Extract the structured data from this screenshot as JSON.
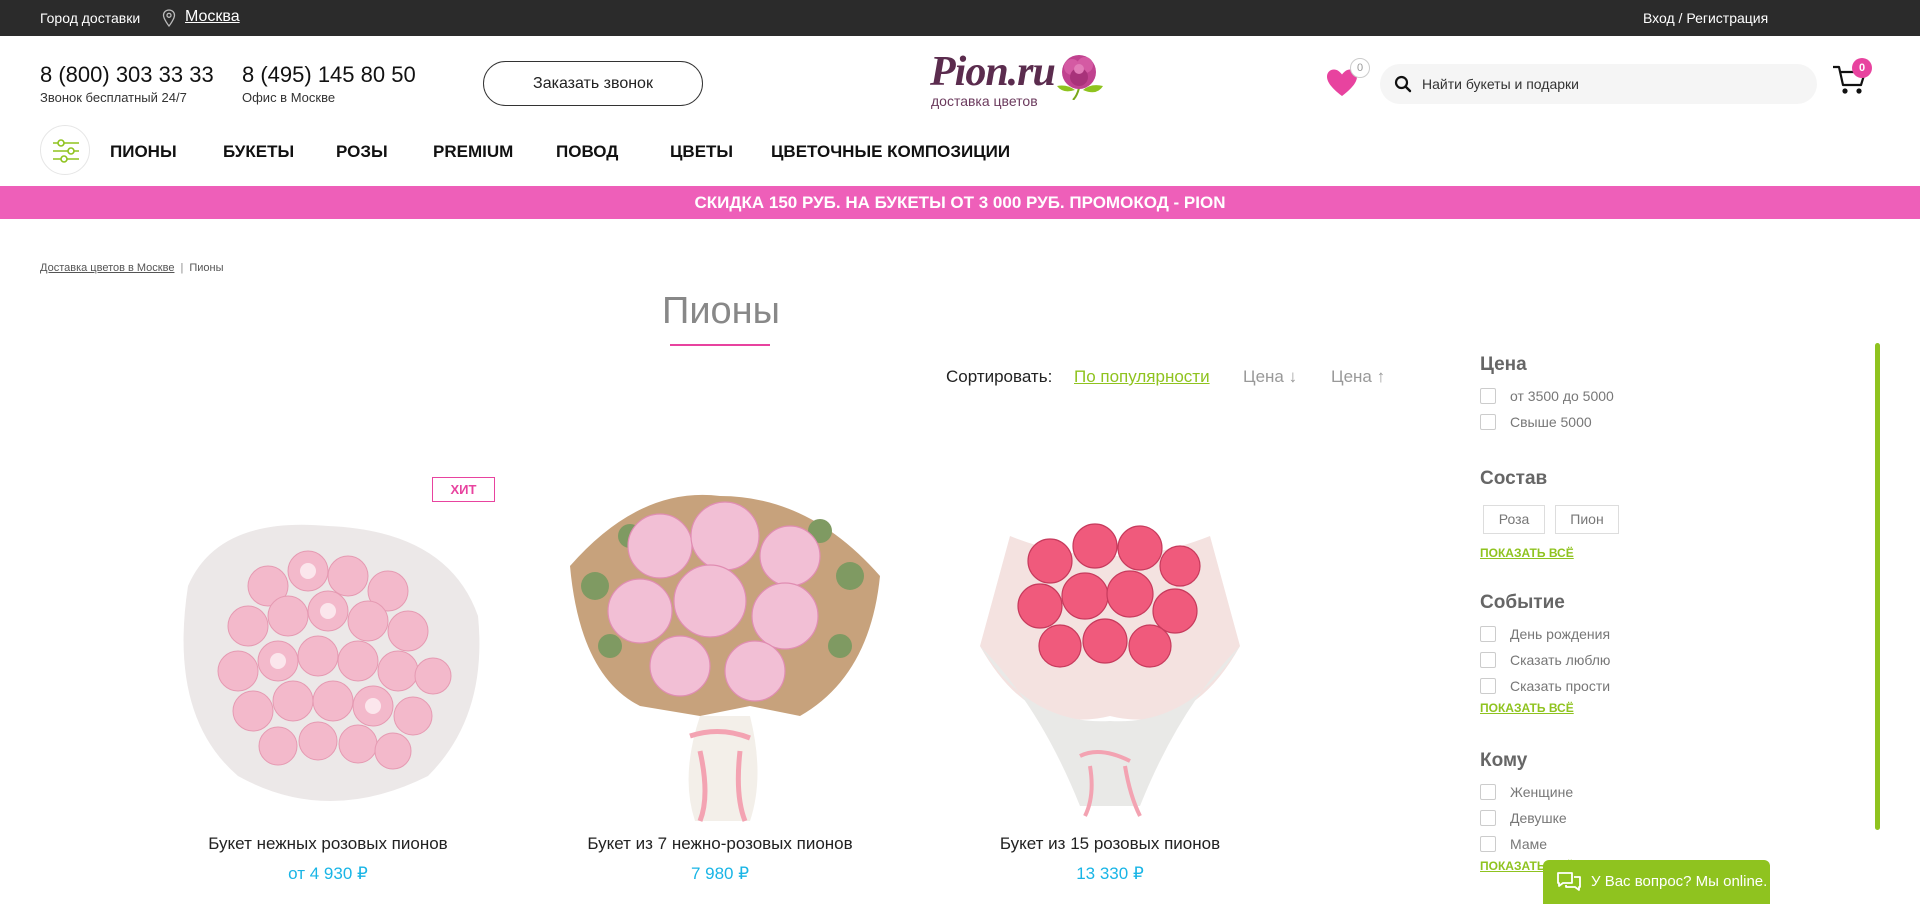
{
  "topbar": {
    "city_label": "Город доставки",
    "city": "Москва",
    "auth": "Вход / Регистрация"
  },
  "header": {
    "phone1": "8 (800) 303 33 33",
    "phone1_sub": "Звонок бесплатный 24/7",
    "phone2": "8 (495) 145 80 50",
    "phone2_sub": "Офис в Москве",
    "callback_label": "Заказать звонок",
    "logo_text": "Pion.ru",
    "logo_sub": "доставка цветов",
    "wishlist_count": "0",
    "search_placeholder": "Найти букеты и подарки",
    "cart_count": "0"
  },
  "nav": {
    "items": [
      "ПИОНЫ",
      "БУКЕТЫ",
      "РОЗЫ",
      "PREMIUM",
      "ПОВОД",
      "ЦВЕТЫ",
      "ЦВЕТОЧНЫЕ КОМПОЗИЦИИ"
    ]
  },
  "promo": "СКИДКА 150 РУБ. НА БУКЕТЫ ОТ 3 000 РУБ. ПРОМОКОД - PION",
  "breadcrumb": {
    "home": "Доставка цветов в Москве",
    "current": "Пионы"
  },
  "page_title": "Пионы",
  "sort": {
    "label": "Сортировать:",
    "options": [
      "По популярности",
      "Цена ↓",
      "Цена ↑"
    ],
    "active": "По популярности"
  },
  "products": [
    {
      "name": "Букет нежных розовых пионов",
      "price": "от 4 930 ₽",
      "badge": "ХИТ"
    },
    {
      "name": "Букет из 7 нежно-розовых пионов",
      "price": "7 980 ₽"
    },
    {
      "name": "Букет из 15 розовых пионов",
      "price": "13 330 ₽"
    }
  ],
  "filters": {
    "price": {
      "title": "Цена",
      "options": [
        "от 3500 до 5000",
        "Свыше 5000"
      ]
    },
    "composition": {
      "title": "Состав",
      "tags": [
        "Роза",
        "Пион"
      ],
      "more": "ПОКАЗАТЬ ВСЁ"
    },
    "event": {
      "title": "Событие",
      "options": [
        "День рождения",
        "Сказать люблю",
        "Сказать прости"
      ],
      "more": "ПОКАЗАТЬ ВСЁ"
    },
    "recipient": {
      "title": "Кому",
      "options": [
        "Женщине",
        "Девушке",
        "Маме"
      ],
      "more": "ПОКАЗАТЬ ВСЁ"
    }
  },
  "chat": "У Вас вопрос? Мы online.",
  "colors": {
    "accent_pink": "#e8439f",
    "promo_pink": "#ee5fb9",
    "green": "#8fc31f",
    "price_blue": "#19b5e6"
  }
}
